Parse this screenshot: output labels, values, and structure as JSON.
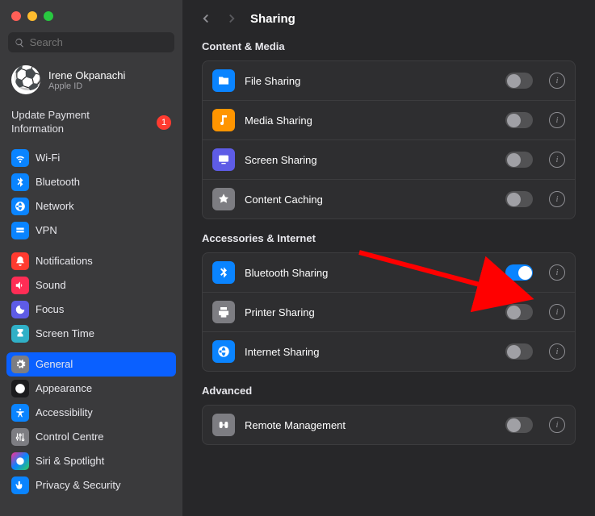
{
  "window": {
    "title": "Sharing",
    "search_placeholder": "Search"
  },
  "profile": {
    "name": "Irene Okpanachi",
    "subtitle": "Apple ID"
  },
  "update": {
    "text": "Update Payment Information",
    "badge": "1"
  },
  "sidebar": {
    "group1": [
      {
        "label": "Wi-Fi",
        "icon": "wifi",
        "color": "ic-blue"
      },
      {
        "label": "Bluetooth",
        "icon": "bluetooth",
        "color": "ic-blue"
      },
      {
        "label": "Network",
        "icon": "globe",
        "color": "ic-blue"
      },
      {
        "label": "VPN",
        "icon": "vpn",
        "color": "ic-blue"
      }
    ],
    "group2": [
      {
        "label": "Notifications",
        "icon": "bell",
        "color": "ic-red"
      },
      {
        "label": "Sound",
        "icon": "sound",
        "color": "ic-pink"
      },
      {
        "label": "Focus",
        "icon": "moon",
        "color": "ic-purple"
      },
      {
        "label": "Screen Time",
        "icon": "hourglass",
        "color": "ic-teal"
      }
    ],
    "group3": [
      {
        "label": "General",
        "icon": "gear",
        "color": "ic-gray",
        "selected": true
      },
      {
        "label": "Appearance",
        "icon": "appearance",
        "color": "ic-black"
      },
      {
        "label": "Accessibility",
        "icon": "accessibility",
        "color": "ic-blue"
      },
      {
        "label": "Control Centre",
        "icon": "control",
        "color": "ic-gray"
      },
      {
        "label": "Siri & Spotlight",
        "icon": "siri",
        "color": "ic-multi"
      },
      {
        "label": "Privacy & Security",
        "icon": "hand",
        "color": "ic-blue"
      }
    ]
  },
  "sections": [
    {
      "title": "Content & Media",
      "rows": [
        {
          "label": "File Sharing",
          "icon": "folder",
          "color": "ric-blue",
          "on": false
        },
        {
          "label": "Media Sharing",
          "icon": "media",
          "color": "ric-orange",
          "on": false
        },
        {
          "label": "Screen Sharing",
          "icon": "screen",
          "color": "ric-purple",
          "on": false
        },
        {
          "label": "Content Caching",
          "icon": "cache",
          "color": "ric-gray",
          "on": false
        }
      ]
    },
    {
      "title": "Accessories & Internet",
      "rows": [
        {
          "label": "Bluetooth Sharing",
          "icon": "bluetooth",
          "color": "ric-blue",
          "on": true
        },
        {
          "label": "Printer Sharing",
          "icon": "printer",
          "color": "ric-gray",
          "on": false
        },
        {
          "label": "Internet Sharing",
          "icon": "globe",
          "color": "ric-globe",
          "on": false
        }
      ]
    },
    {
      "title": "Advanced",
      "rows": [
        {
          "label": "Remote Management",
          "icon": "binoc",
          "color": "ric-gray",
          "on": false
        }
      ]
    }
  ]
}
